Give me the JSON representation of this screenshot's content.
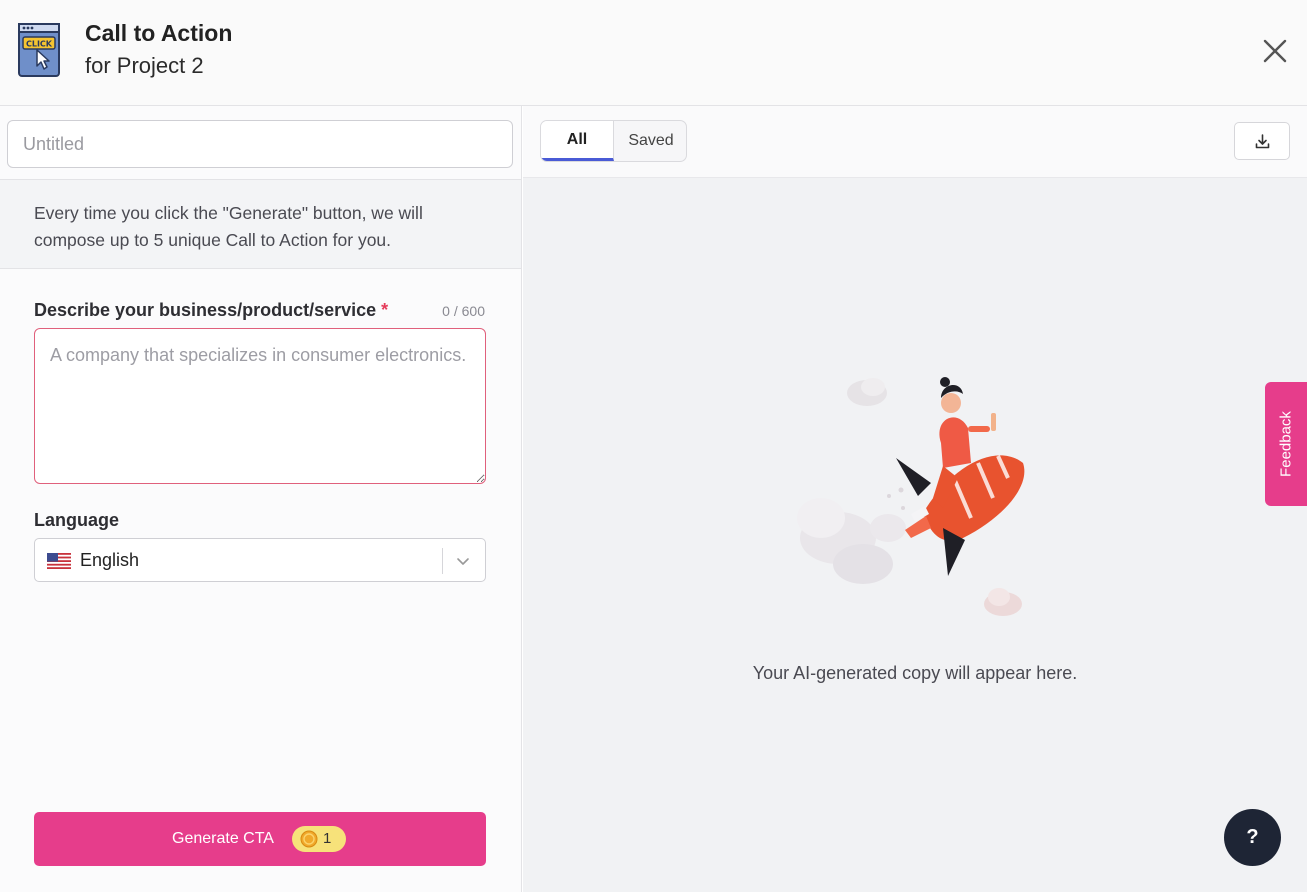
{
  "header": {
    "title": "Call to Action",
    "subtitle": "for Project 2",
    "app_icon_text": "CLICK"
  },
  "form": {
    "name_placeholder": "Untitled",
    "info_text": "Every time you click the \"Generate\" button, we will compose up to 5 unique Call to Action for you.",
    "description_label": "Describe your business/product/service",
    "required_mark": "*",
    "char_count": "0 / 600",
    "description_placeholder": "A company that specializes in consumer electronics.",
    "language_label": "Language",
    "language_value": "English",
    "generate_label": "Generate CTA",
    "credit_cost": "1"
  },
  "results": {
    "tabs": [
      "All",
      "Saved"
    ],
    "active_tab": "All",
    "empty_message": "Your AI-generated copy will appear here."
  },
  "feedback_label": "Feedback",
  "help_label": "?",
  "colors": {
    "accent": "#e63d8b",
    "tab_underline": "#4a5bd6",
    "help_button": "#1e2535",
    "credit_pill": "#f7e27a"
  }
}
